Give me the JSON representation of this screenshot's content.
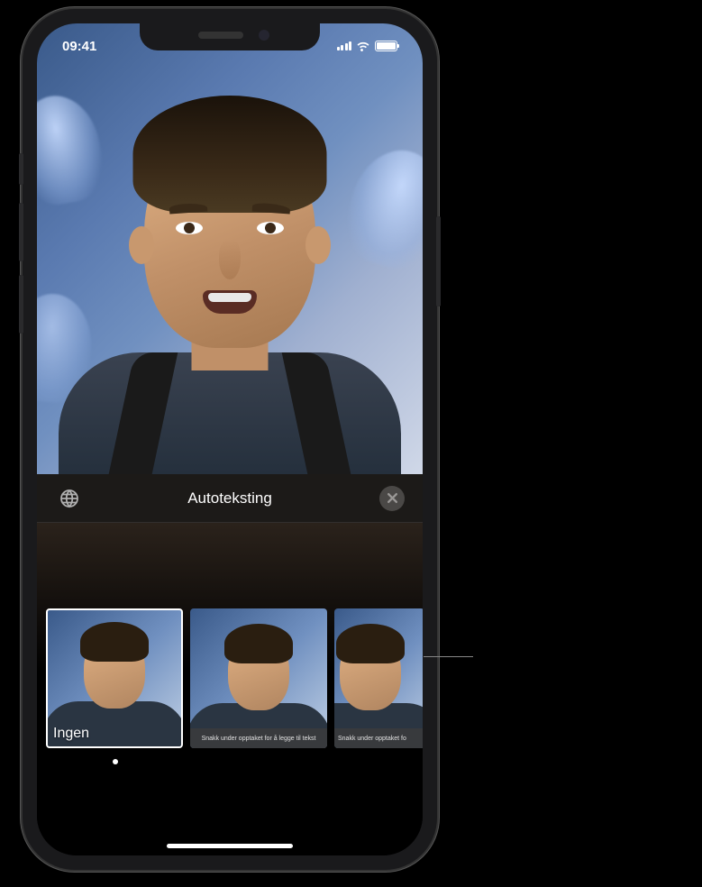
{
  "status_bar": {
    "time": "09:41"
  },
  "panel": {
    "title": "Autoteksting"
  },
  "thumbnails": [
    {
      "label": "Ingen",
      "caption": null,
      "selected": true
    },
    {
      "label": null,
      "caption": "Snakk under opptaket for å legge til tekst",
      "selected": false
    },
    {
      "label": null,
      "caption": "Snakk under opptaket fo",
      "selected": false
    }
  ],
  "icons": {
    "language": "globe-icon",
    "close": "close-icon"
  }
}
